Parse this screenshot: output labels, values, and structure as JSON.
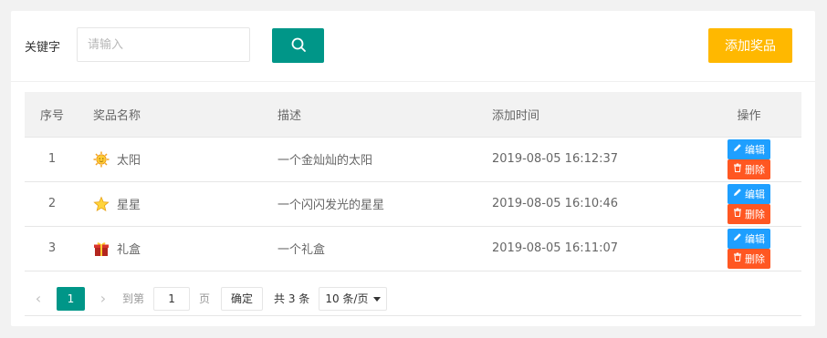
{
  "toolbar": {
    "keyword_label": "关键字",
    "search_placeholder": "请输入",
    "search_value": "",
    "add_label": "添加奖品",
    "colors": {
      "search": "#009688",
      "add": "#ffb800"
    }
  },
  "table": {
    "headers": {
      "index": "序号",
      "name": "奖品名称",
      "desc": "描述",
      "time": "添加时间",
      "ops": "操作"
    },
    "rows": [
      {
        "index": "1",
        "icon": "sun-icon",
        "name": "太阳",
        "desc": "一个金灿灿的太阳",
        "time": "2019-08-05 16:12:37"
      },
      {
        "index": "2",
        "icon": "star-icon",
        "name": "星星",
        "desc": "一个闪闪发光的星星",
        "time": "2019-08-05 16:10:46"
      },
      {
        "index": "3",
        "icon": "gift-icon",
        "name": "礼盒",
        "desc": "一个礼盒",
        "time": "2019-08-05 16:11:07"
      }
    ],
    "edit_label": "编辑",
    "delete_label": "删除",
    "colors": {
      "edit": "#1e9fff",
      "delete": "#ff5722"
    }
  },
  "pager": {
    "current_page": "1",
    "goto_label": "到第",
    "goto_value": "1",
    "page_unit": "页",
    "confirm_label": "确定",
    "total_label": "共 3 条",
    "page_size": "10 条/页"
  }
}
